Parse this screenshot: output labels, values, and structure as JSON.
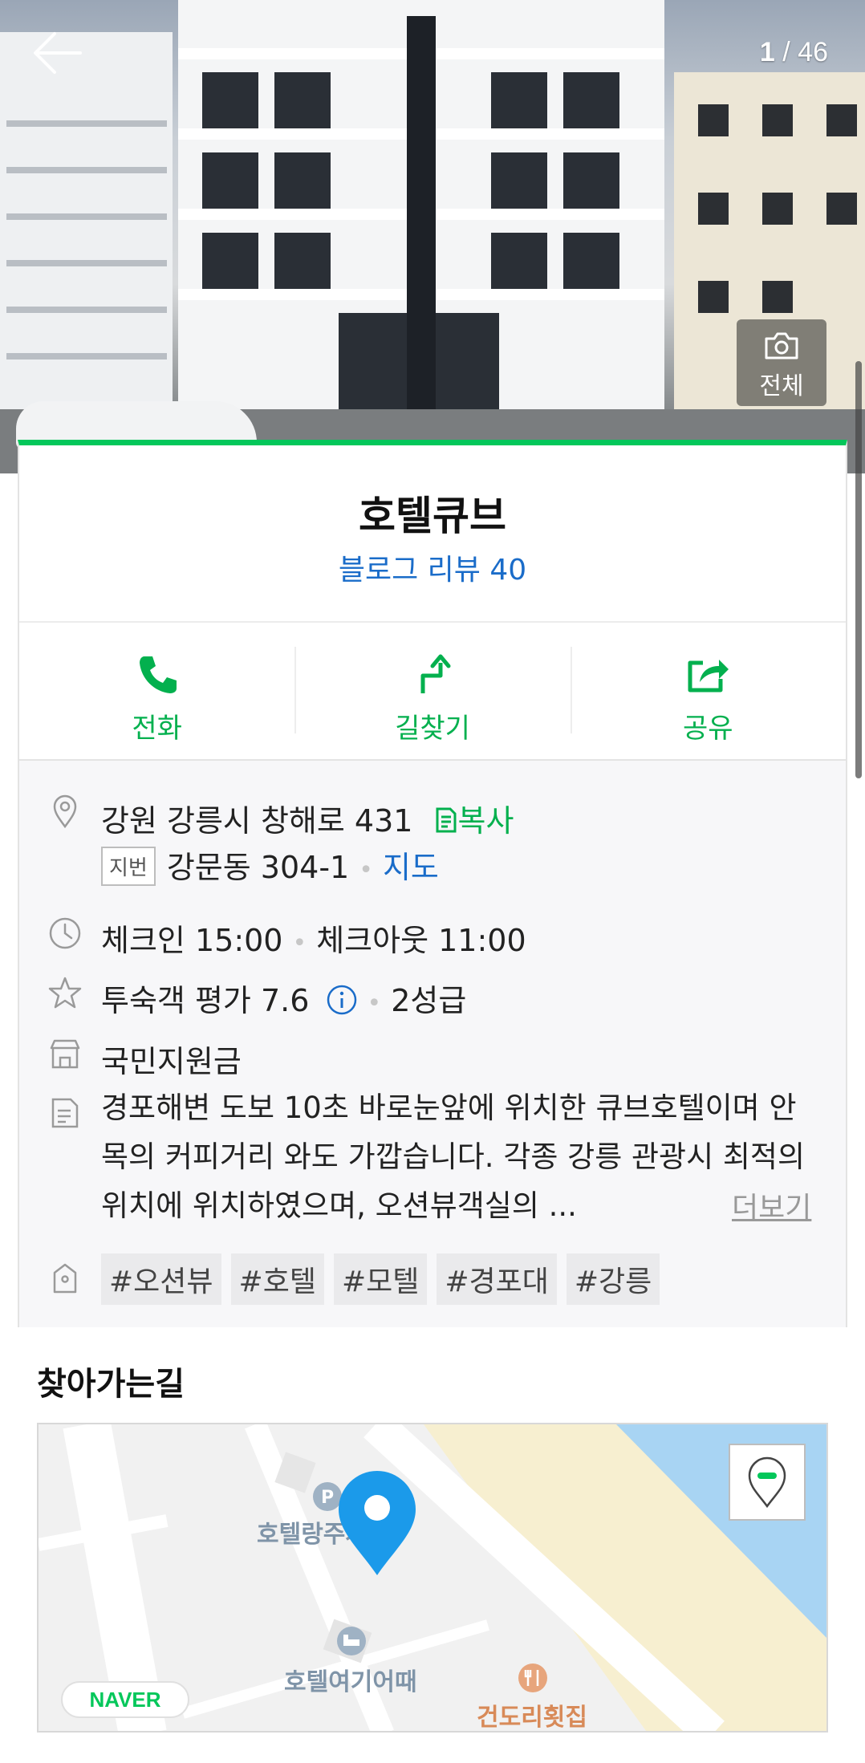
{
  "hero": {
    "counter_current": "1",
    "counter_total": "/ 46",
    "photos_label": "전체"
  },
  "place": {
    "name": "호텔큐브",
    "review_link": "블로그 리뷰 40"
  },
  "actions": [
    {
      "label": "전화",
      "icon": "phone-icon"
    },
    {
      "label": "길찾기",
      "icon": "directions-icon"
    },
    {
      "label": "공유",
      "icon": "share-icon"
    }
  ],
  "info": {
    "address": "강원 강릉시 창해로 431",
    "copy_label": "복사",
    "jibun_badge": "지번",
    "jibun_address": "강문동 304-1",
    "map_link": "지도",
    "checkin": "체크인 15:00",
    "checkout": "체크아웃 11:00",
    "rating": "투숙객 평가 7.6",
    "grade": "2성급",
    "support": "국민지원금",
    "description": "경포해변 도보 10초 바로눈앞에 위치한 큐브호텔이며 안목의 커피거리 와도 가깝습니다. 각종 강릉 관광시 최적의 위치에 위치하였으며, 오션뷰객실의 ...",
    "more_label": "더보기",
    "tags": [
      "#오션뷰",
      "#호텔",
      "#모텔",
      "#경포대",
      "#강릉"
    ]
  },
  "directions": {
    "title": "찾아가는길",
    "map_labels": {
      "parking": "호텔랑주차장",
      "hotel": "호텔여기어때",
      "restaurant": "건도리횟집"
    },
    "map_brand": "NAVER"
  },
  "colors": {
    "accent_green": "#03c75a",
    "link_blue": "#1a6cc9",
    "map_sea": "#a8d4f3",
    "map_sand": "#f7efd0",
    "pin_blue": "#1b9aea"
  }
}
